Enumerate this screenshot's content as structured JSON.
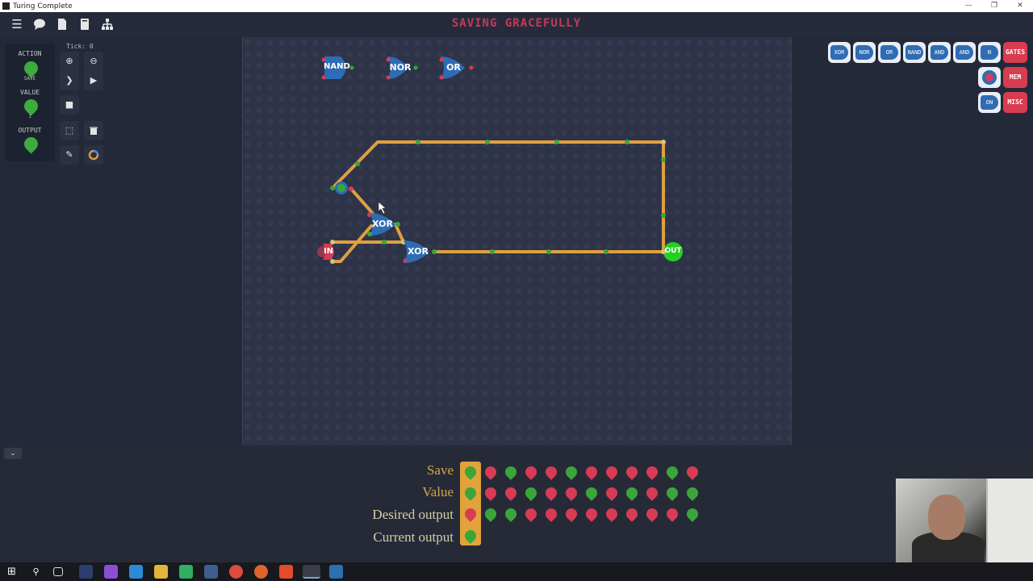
{
  "window": {
    "title": "Turing Complete",
    "controls": [
      "—",
      "❐",
      "✕"
    ]
  },
  "topbar": {
    "level_title": "SAVING GRACEFULLY",
    "icons": [
      "menu-icon",
      "chat-icon",
      "file-icon",
      "book-icon",
      "hierarchy-icon"
    ]
  },
  "io_panel": {
    "action_label": "ACTION",
    "action_sub": "SAVE",
    "value_label": "VALUE",
    "value_sub": "1",
    "output_label": "OUTPUT"
  },
  "tools": {
    "tick_label": "Tick: 0"
  },
  "board_gates": {
    "nand": "NAND",
    "nor": "NOR",
    "or": "OR",
    "xor1": "XOR",
    "xor2": "XOR",
    "input": "IN",
    "output": "OUT"
  },
  "palette": {
    "gates": [
      "XOR",
      "NOR",
      "OR",
      "NAND",
      "AND",
      "AND",
      "N"
    ],
    "tabs": {
      "gates": "GATES",
      "mem": "MEM",
      "misc": "MISC"
    },
    "row3_label": "ON"
  },
  "test_table": {
    "rows": [
      {
        "label": "Save",
        "bits": [
          "g",
          "r",
          "g",
          "r",
          "r",
          "g",
          "r",
          "r",
          "r",
          "r",
          "g",
          "r"
        ]
      },
      {
        "label": "Value",
        "bits": [
          "g",
          "r",
          "r",
          "g",
          "r",
          "r",
          "g",
          "r",
          "g",
          "r",
          "g",
          "g"
        ]
      },
      {
        "label": "Desired output",
        "bits": [
          "r",
          "g",
          "g",
          "r",
          "r",
          "r",
          "r",
          "r",
          "r",
          "r",
          "r",
          "g"
        ]
      },
      {
        "label": "Current output",
        "bits": [
          "g"
        ]
      }
    ]
  },
  "colors": {
    "accent_red": "#d83b55",
    "accent_green": "#3aa63a",
    "wire": "#e0a040",
    "gate_blue": "#2e6cb5",
    "output_on": "#23d023"
  }
}
